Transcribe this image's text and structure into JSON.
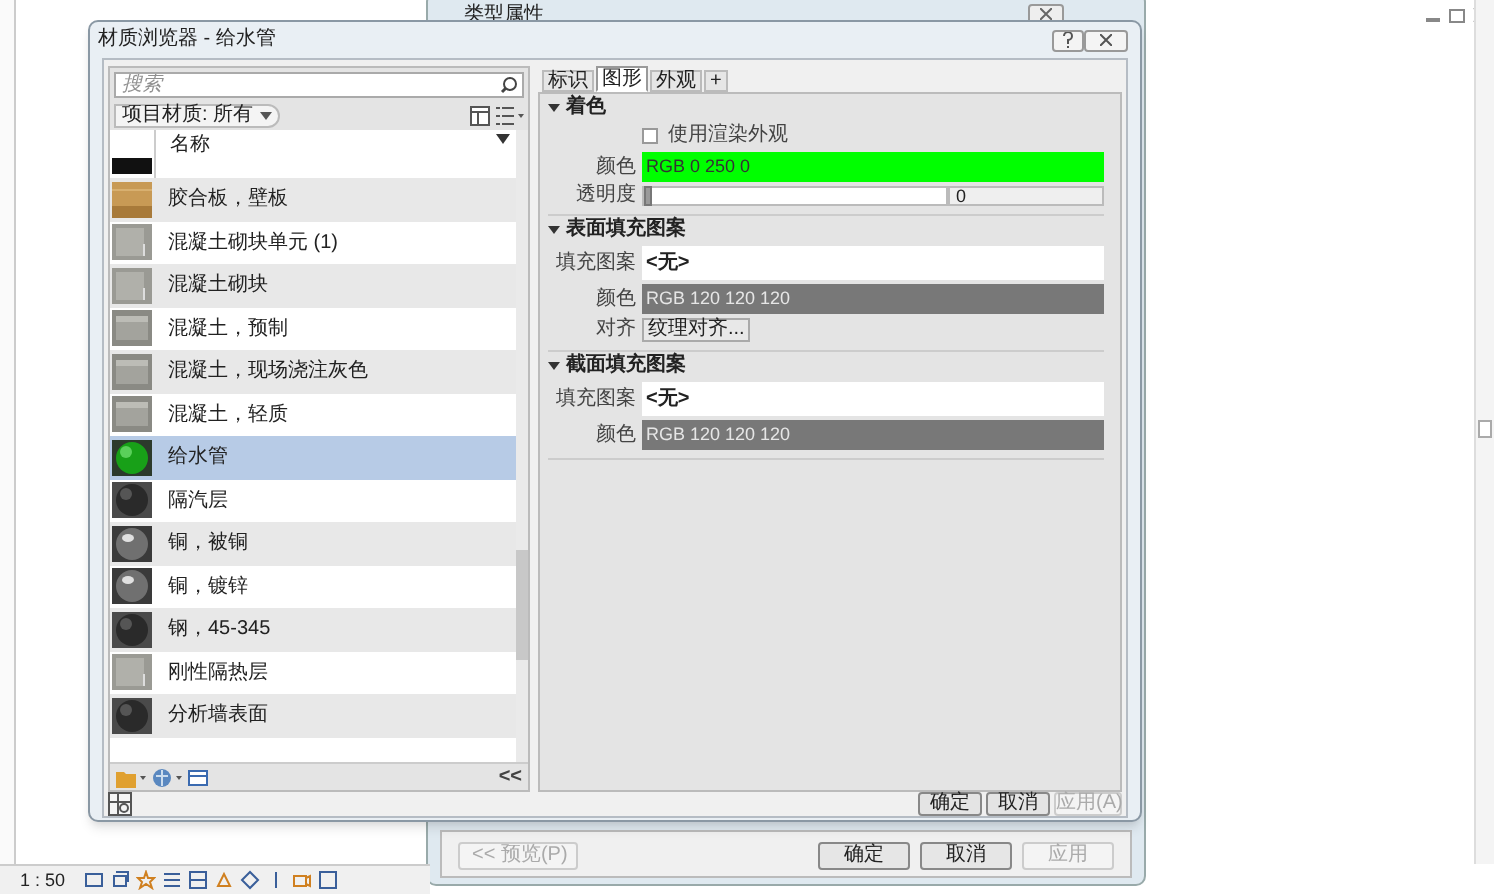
{
  "background_window": {
    "title": "类型属性",
    "buttons": [
      {
        "label": "<< 预览(P)",
        "disabled": true
      },
      {
        "label": "确定",
        "disabled": false
      },
      {
        "label": "取消",
        "disabled": false
      },
      {
        "label": "应用",
        "disabled": true
      }
    ]
  },
  "dialog": {
    "title": "材质浏览器 - 给水管",
    "search": {
      "placeholder": "搜索"
    },
    "filter": "项目材质: 所有",
    "list_header": "名称",
    "materials": [
      {
        "name": "胶合板，壁板",
        "kind": "wood",
        "selected": false
      },
      {
        "name": "混凝土砌块单元 (1)",
        "kind": "block",
        "selected": false
      },
      {
        "name": "混凝土砌块",
        "kind": "block",
        "selected": false
      },
      {
        "name": "混凝土，预制",
        "kind": "concrete",
        "selected": false
      },
      {
        "name": "混凝土，现场浇注灰色",
        "kind": "concrete",
        "selected": false
      },
      {
        "name": "混凝土，轻质",
        "kind": "concrete",
        "selected": false
      },
      {
        "name": "给水管",
        "kind": "green",
        "selected": true
      },
      {
        "name": "隔汽层",
        "kind": "dark",
        "selected": false
      },
      {
        "name": "铜，被铜",
        "kind": "metal",
        "selected": false
      },
      {
        "name": "铜，镀锌",
        "kind": "metal",
        "selected": false
      },
      {
        "name": "钢，45-345",
        "kind": "dark",
        "selected": false
      },
      {
        "name": "刚性隔热层",
        "kind": "block",
        "selected": false
      },
      {
        "name": "分析墙表面",
        "kind": "dark",
        "selected": false
      }
    ],
    "tabs": [
      {
        "label": "标识",
        "selected": false
      },
      {
        "label": "图形",
        "selected": true
      },
      {
        "label": "外观",
        "selected": false
      },
      {
        "label": "+",
        "selected": false
      }
    ],
    "sections": [
      {
        "title": "着色",
        "expanded": true,
        "rows": [
          {
            "kind": "checkbox",
            "label": "使用渲染外观",
            "checked": false
          },
          {
            "kind": "color",
            "label": "颜色",
            "value": "RGB 0 250 0",
            "color": "#00ff00"
          },
          {
            "kind": "slider",
            "label": "透明度",
            "level": 0,
            "value": "0"
          }
        ]
      },
      {
        "title": "表面填充图案",
        "expanded": true,
        "rows": [
          {
            "kind": "text",
            "label": "填充图案",
            "value": "<无>"
          },
          {
            "kind": "color",
            "label": "颜色",
            "value": "RGB 120 120 120",
            "color": "#787878"
          },
          {
            "kind": "button",
            "label": "对齐",
            "value": "纹理对齐..."
          }
        ]
      },
      {
        "title": "截面填充图案",
        "expanded": true,
        "rows": [
          {
            "kind": "text",
            "label": "填充图案",
            "value": "<无>"
          },
          {
            "kind": "color",
            "label": "颜色",
            "value": "RGB 120 120 120",
            "color": "#787878"
          }
        ]
      }
    ],
    "collapse": "<<",
    "buttons": [
      {
        "label": "确定",
        "disabled": false
      },
      {
        "label": "取消",
        "disabled": false
      },
      {
        "label": "应用(A)",
        "disabled": true
      }
    ]
  },
  "status_bar": {
    "scale": "1 : 50"
  }
}
